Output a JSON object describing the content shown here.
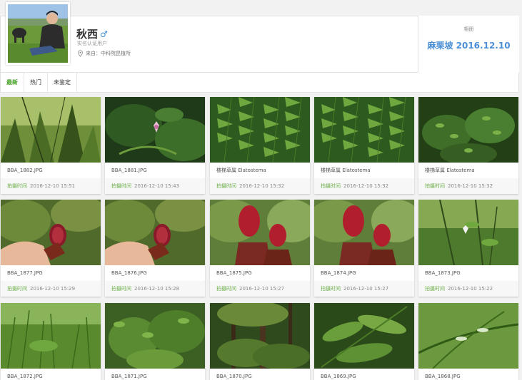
{
  "profile": {
    "name": "秋西",
    "gender_icon": "♂",
    "verify_label": "实名认证用户",
    "origin_text": "来自：中科院昆植所"
  },
  "album": {
    "label": "相册",
    "title": "麻栗坡 2016.12.10"
  },
  "tabs": [
    {
      "label": "最新",
      "active": true
    },
    {
      "label": "热门",
      "active": false
    },
    {
      "label": "未鉴定",
      "active": false
    }
  ],
  "time_label": "拍摄时间",
  "photos": [
    {
      "name": "BBA_1882.JPG",
      "time": "2016-12-10 15:51",
      "scene": "forest"
    },
    {
      "name": "BBA_1881.JPG",
      "time": "2016-12-10 15:43",
      "scene": "flower"
    },
    {
      "name": "楼梯草属 Elatostema",
      "time": "2016-12-10 15:32",
      "scene": "leaves"
    },
    {
      "name": "楼梯草属 Elatostema",
      "time": "2016-12-10 15:32",
      "scene": "leaves"
    },
    {
      "name": "楼梯草属 Elatostema",
      "time": "2016-12-10 15:32",
      "scene": "leaves-dark"
    },
    {
      "name": "BBA_1877.JPG",
      "time": "2016-12-10 15:29",
      "scene": "hand-red"
    },
    {
      "name": "BBA_1876.JPG",
      "time": "2016-12-10 15:28",
      "scene": "hand-red"
    },
    {
      "name": "BBA_1875.JPG",
      "time": "2016-12-10 15:27",
      "scene": "red-bulbs"
    },
    {
      "name": "BBA_1874.JPG",
      "time": "2016-12-10 15:27",
      "scene": "red-bulbs"
    },
    {
      "name": "BBA_1873.JPG",
      "time": "2016-12-10 15:22",
      "scene": "stems-flower"
    },
    {
      "name": "BBA_1872.JPG",
      "time": "",
      "scene": "grass"
    },
    {
      "name": "BBA_1871.JPG",
      "time": "",
      "scene": "shrub"
    },
    {
      "name": "BBA_1870.JPG",
      "time": "",
      "scene": "forest-dark"
    },
    {
      "name": "BBA_1869.JPG",
      "time": "",
      "scene": "broad-leaves"
    },
    {
      "name": "BBA_1868.JPG",
      "time": "",
      "scene": "stems"
    }
  ],
  "colors": {
    "accent_green": "#4aa62b",
    "album_blue": "#4a8fd6"
  }
}
